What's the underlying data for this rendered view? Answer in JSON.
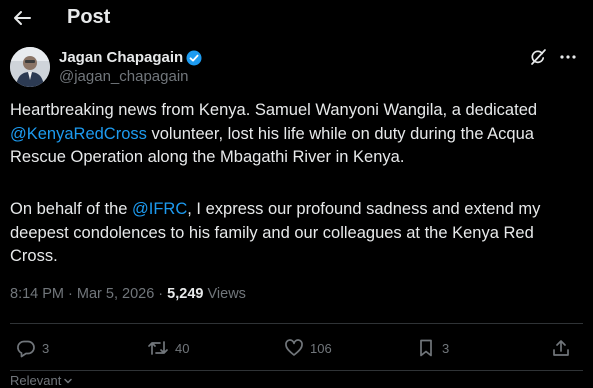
{
  "header": {
    "back_icon": "arrow-left-icon",
    "title": "Post"
  },
  "author": {
    "name": "Jagan Chapagain",
    "handle": "@jagan_chapagain",
    "verified_icon": "verified-badge-icon",
    "verified_color": "#1d9bf0"
  },
  "top_actions": {
    "grok_icon": "grok-icon",
    "more_icon": "more-icon"
  },
  "post": {
    "p1_text_a": "Heartbreaking news from Kenya. Samuel Wanyoni Wangila, a dedicated ",
    "p1_mention": "@KenyaRedCross",
    "p1_text_b": " volunteer, lost his life while on duty during the Acqua Rescue Operation along the Mbagathi River in Kenya.",
    "p2_text_a": "On behalf of the ",
    "p2_mention": "@IFRC",
    "p2_text_b": ", I express our profound sadness and extend my deepest condolences to his family and our colleagues at the Kenya Red Cross."
  },
  "meta": {
    "time": "8:14 PM",
    "separator": " · ",
    "date": "Mar 5, 2026",
    "views_count": "5,249",
    "views_label": " Views"
  },
  "actions": {
    "reply": {
      "icon": "reply-icon",
      "count": "3"
    },
    "repost": {
      "icon": "repost-icon",
      "count": "40"
    },
    "like": {
      "icon": "heart-icon",
      "count": "106"
    },
    "bookmark": {
      "icon": "bookmark-icon",
      "count": "3"
    },
    "share": {
      "icon": "share-icon"
    }
  },
  "sort": {
    "label": "Relevant",
    "icon": "chevron-down-icon"
  },
  "colors": {
    "background": "#000000",
    "text": "#e7e9ea",
    "secondary": "#71767b",
    "link": "#1d9bf0",
    "divider": "#2f3336"
  }
}
